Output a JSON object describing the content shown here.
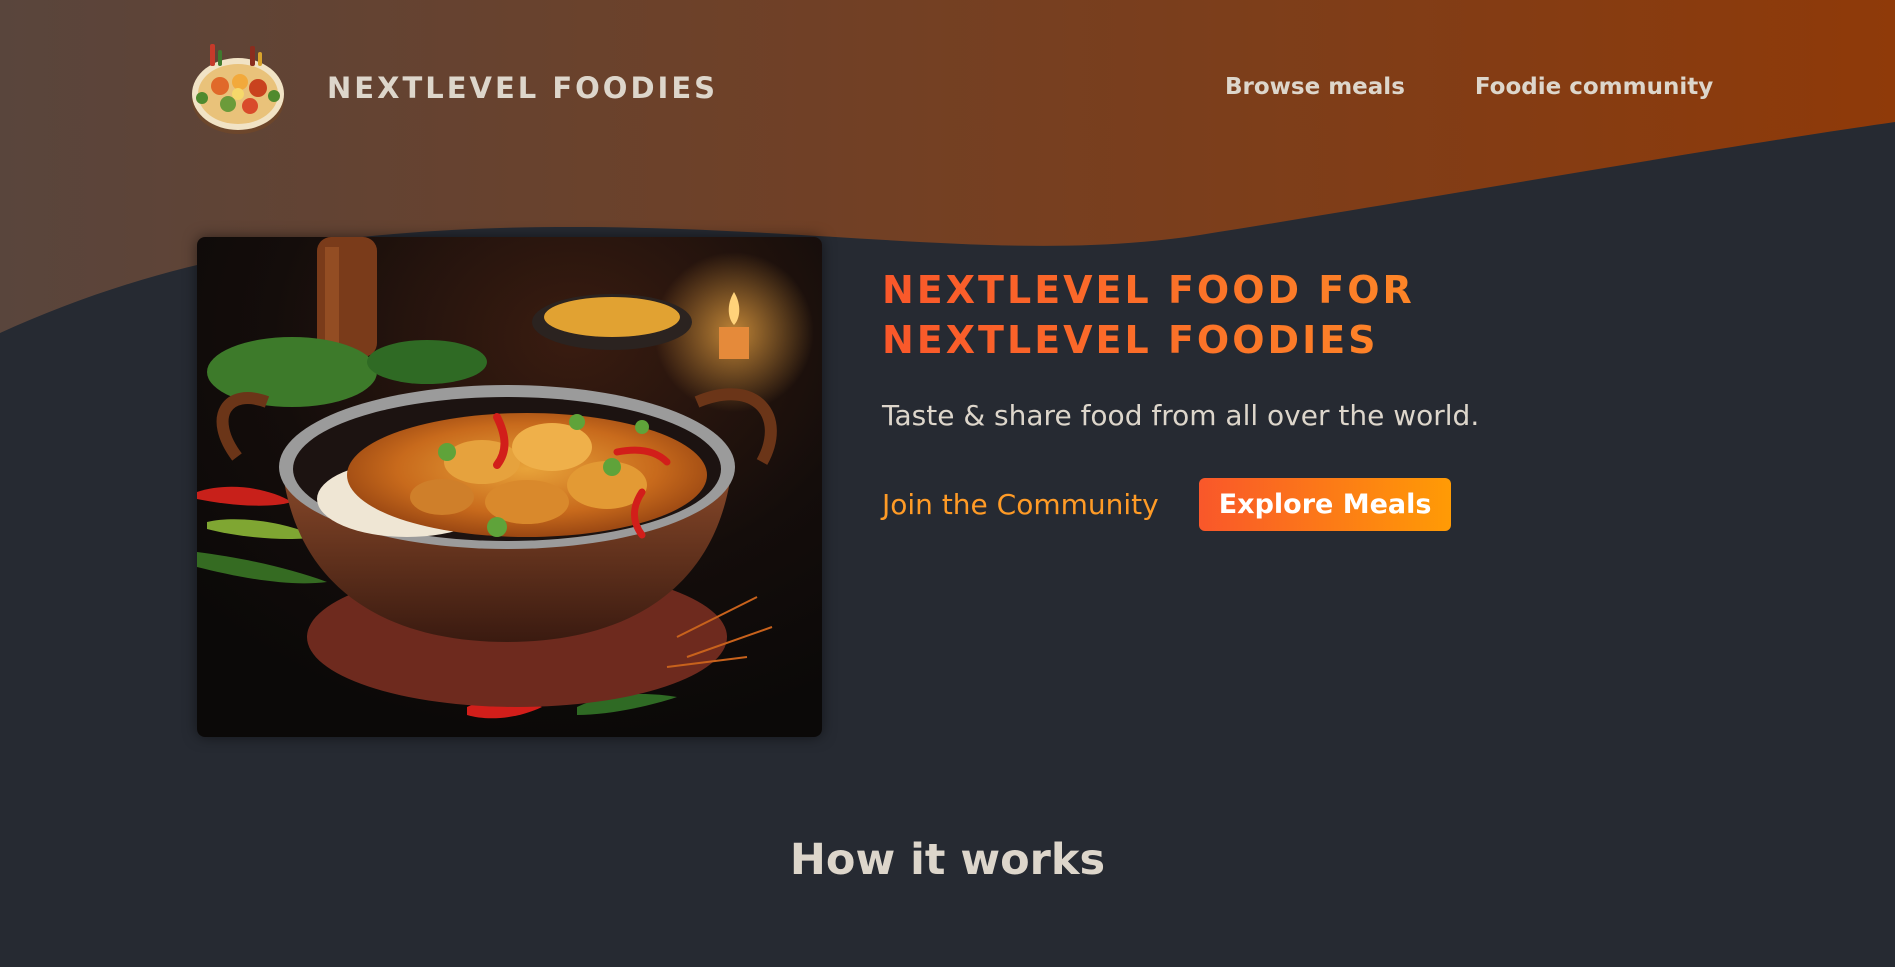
{
  "header": {
    "logo_icon": "food-plate-icon",
    "logo_text": "NEXTLEVEL FOODIES",
    "nav": [
      {
        "label": "Browse meals"
      },
      {
        "label": "Foodie community"
      }
    ]
  },
  "hero": {
    "image_subject": "chicken-curry-bowl",
    "title": "NEXTLEVEL FOOD FOR NEXTLEVEL FOODIES",
    "subtitle": "Taste & share food from all over the world.",
    "join_link": "Join the Community",
    "explore_button": "Explore Meals"
  },
  "section": {
    "title": "How it works"
  },
  "colors": {
    "background": "#262a32",
    "header_gradient_start": "#59453c",
    "header_gradient_end": "#8f3a09",
    "accent_orange": "#ff9b26",
    "accent_red": "#f9572a",
    "text_light": "#ddd6cb"
  }
}
